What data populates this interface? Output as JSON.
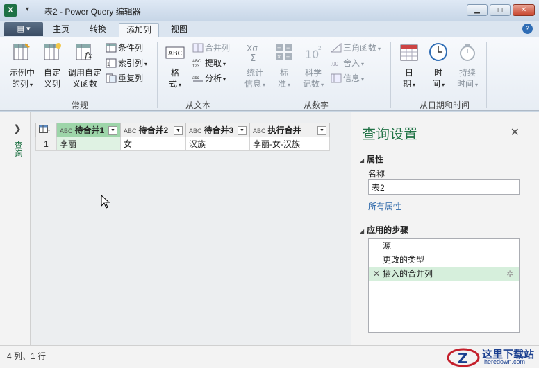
{
  "window": {
    "app_icon": "X",
    "title": "表2 - Power Query 编辑器",
    "qat_button": "▾",
    "controls": [
      "minimize-icon",
      "maximize-icon",
      "close-icon"
    ]
  },
  "tabs": {
    "file": "▤ ▾",
    "items": [
      "主页",
      "转换",
      "添加列",
      "视图"
    ],
    "active": "添加列",
    "help": "?"
  },
  "ribbon": {
    "groups": {
      "general": {
        "label": "常规",
        "example_col": [
          "示例中",
          "的列"
        ],
        "custom_col": [
          "自定",
          "义列"
        ],
        "invoke_fn": [
          "调用自定",
          "义函数"
        ],
        "cond_col": "条件列",
        "index_col": "索引列",
        "dup_col": "重复列"
      },
      "text": {
        "label": "从文本",
        "format": [
          "格",
          "式"
        ],
        "merge_cols": "合并列",
        "extract": "提取",
        "parse": "分析"
      },
      "number": {
        "label": "从数字",
        "stats": [
          "统计",
          "信息"
        ],
        "standard": [
          "标",
          "准"
        ],
        "scientific": [
          "科学",
          "记数"
        ],
        "trig": "三角函数",
        "rounding": "舍入",
        "info": "信息"
      },
      "datetime": {
        "label": "从日期和时间",
        "date": [
          "日",
          "期"
        ],
        "time": [
          "时",
          "间"
        ],
        "duration": [
          "持续",
          "时间"
        ]
      }
    }
  },
  "left_pane": {
    "label": "查询"
  },
  "grid": {
    "type_icon": "ABC",
    "columns": [
      "待合并1",
      "待合并2",
      "待合并3",
      "执行合并"
    ],
    "rows": [
      {
        "num": "1",
        "cells": [
          "李丽",
          "女",
          "汉族",
          "李丽-女-汉族"
        ]
      }
    ]
  },
  "query_settings": {
    "title": "查询设置",
    "properties_head": "属性",
    "name_label": "名称",
    "name_value": "表2",
    "all_props": "所有属性",
    "steps_head": "应用的步骤",
    "steps": [
      "源",
      "更改的类型",
      "插入的合并列"
    ]
  },
  "status": {
    "text": "4 列、1 行"
  },
  "watermark": {
    "title": "这里下载站",
    "url": "heredown.com"
  },
  "colors": {
    "accent_green": "#217346",
    "selected_header": "#9dd5a9",
    "selected_step": "#d6efdc"
  }
}
